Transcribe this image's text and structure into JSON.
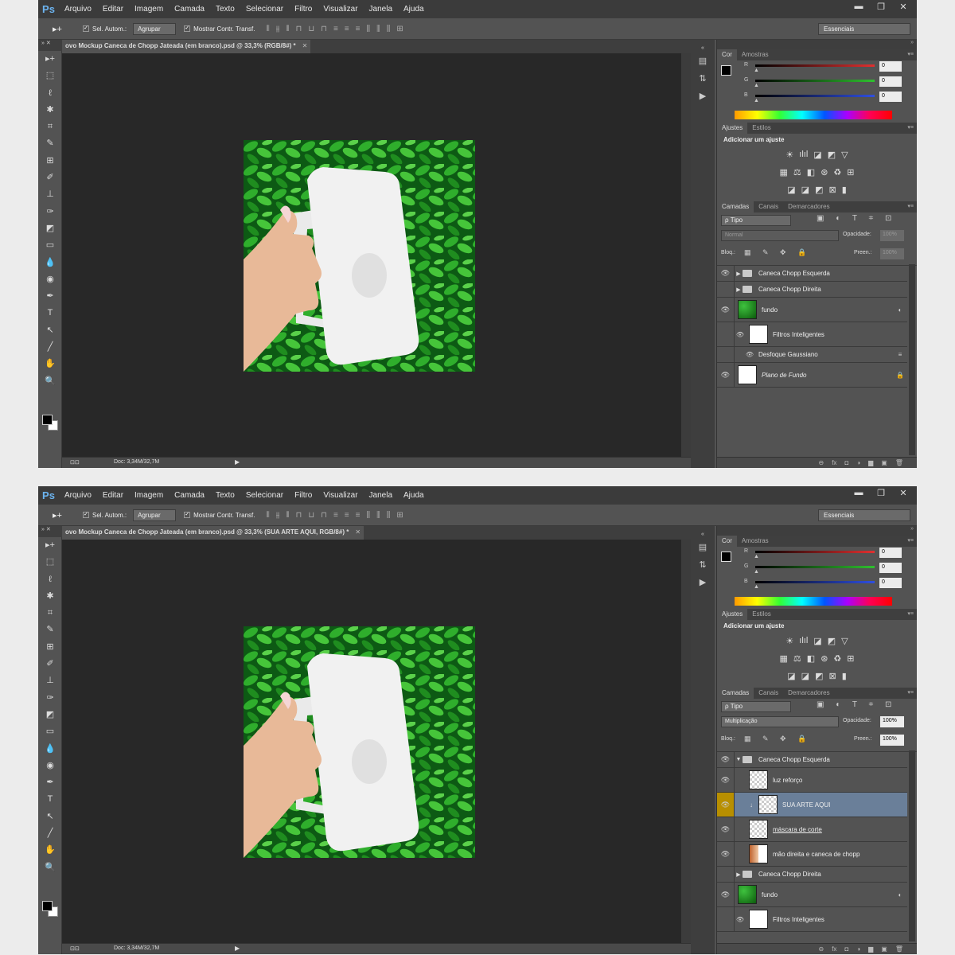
{
  "app": {
    "logo": "Ps",
    "menu": [
      "Arquivo",
      "Editar",
      "Imagem",
      "Camada",
      "Texto",
      "Selecionar",
      "Filtro",
      "Visualizar",
      "Janela",
      "Ajuda"
    ]
  },
  "window_buttons": [
    "▬",
    "❐",
    "✕"
  ],
  "options": {
    "move_icon": "▸+",
    "auto_select": "Sel. Autom.:",
    "auto_select_value": "Agrupar",
    "show_transform": "Mostrar Contr. Transf.",
    "workspace": "Essenciais"
  },
  "toolbox_header": "»  ✕",
  "tools": [
    "▸+",
    "⬚",
    "ℓ",
    "✱",
    "⌗",
    "✎",
    "⊞",
    "✐",
    "⊥",
    "✑",
    "◩",
    "▭",
    "💧",
    "◉",
    "✒",
    "T",
    "↖",
    "╱",
    "✋",
    "🔍"
  ],
  "doc": {
    "tab1": "ovo Mockup Caneca de Chopp Jateada (em branco).psd @ 33,3% (RGB/8#) *",
    "tab2": "ovo Mockup Caneca de Chopp Jateada (em branco).psd @ 33,3% (SUA ARTE AQUI, RGB/8#) *",
    "close": "✕",
    "status": "Doc: 3,34M/32,7M"
  },
  "panel_tabs": {
    "color": [
      "Cor",
      "Amostras"
    ],
    "adjust": [
      "Ajustes",
      "Estilos"
    ],
    "layers": [
      "Camadas",
      "Canais",
      "Demarcadores"
    ]
  },
  "color_sliders": [
    {
      "label": "R",
      "value": "0",
      "color": "#e03030"
    },
    {
      "label": "G",
      "value": "0",
      "color": "#2fc02f"
    },
    {
      "label": "B",
      "value": "0",
      "color": "#2f4fe0"
    }
  ],
  "adjust_title": "Adicionar um ajuste",
  "adjust_rows": [
    [
      "☀",
      "ılıl",
      "◪",
      "◩",
      "▽"
    ],
    [
      "▦",
      "⚖",
      "◧",
      "⊛",
      "♻",
      "⊞"
    ],
    [
      "◪",
      "◪",
      "◩",
      "⊠",
      "▮"
    ]
  ],
  "layer_filter": "ρ Tipo",
  "filter_icons": "▣ ◐ T ⌗ ⊡",
  "shot1": {
    "blend": "Normal",
    "opacity_label": "Opacidade:",
    "opacity": "100%",
    "lock_label": "Bloq.:",
    "lock_icons": "▦ ✎ ✥ 🔒",
    "fill_label": "Preen.:",
    "fill": "100%",
    "layers": [
      {
        "eye": "👁",
        "name": "Caneca Chopp Esquerda",
        "kind": "group"
      },
      {
        "eye": "",
        "name": "Caneca Chopp Direita",
        "kind": "group"
      },
      {
        "eye": "👁",
        "name": "fundo",
        "kind": "smart",
        "right": "◐"
      },
      {
        "eye": "👁",
        "name": "Filtros Inteligentes",
        "kind": "filters"
      },
      {
        "eye": "",
        "name": "Desfoque Gaussiano",
        "kind": "filter-item",
        "right": "≡"
      },
      {
        "eye": "👁",
        "name": "Plano de Fundo",
        "kind": "background",
        "right": "🔒"
      }
    ]
  },
  "shot2": {
    "blend": "Multiplicação",
    "opacity_label": "Opacidade:",
    "opacity": "100%",
    "lock_label": "Bloq.:",
    "lock_icons": "▦ ✎ ✥ 🔒",
    "fill_label": "Preen.:",
    "fill": "100%",
    "layers": [
      {
        "eye": "👁",
        "name": "Caneca Chopp Esquerda",
        "kind": "group-open"
      },
      {
        "eye": "👁",
        "name": "luz reforço",
        "kind": "transp"
      },
      {
        "eye": "👁",
        "name": "SUA ARTE AQUI",
        "kind": "selected"
      },
      {
        "eye": "👁",
        "name": "máscara de corte",
        "kind": "mask"
      },
      {
        "eye": "👁",
        "name": "mão direita e caneca de chopp",
        "kind": "hand"
      },
      {
        "eye": "",
        "name": "Caneca Chopp Direita",
        "kind": "group"
      },
      {
        "eye": "👁",
        "name": "fundo",
        "kind": "smart",
        "right": "◐"
      },
      {
        "eye": "👁",
        "name": "Filtros Inteligentes",
        "kind": "filters"
      }
    ]
  },
  "panel_footer": [
    "⊖",
    "fx",
    "◘",
    "◑",
    "▆",
    "▣",
    "🗑"
  ],
  "narrow_icons": [
    "▤",
    "⇅",
    "▶"
  ]
}
